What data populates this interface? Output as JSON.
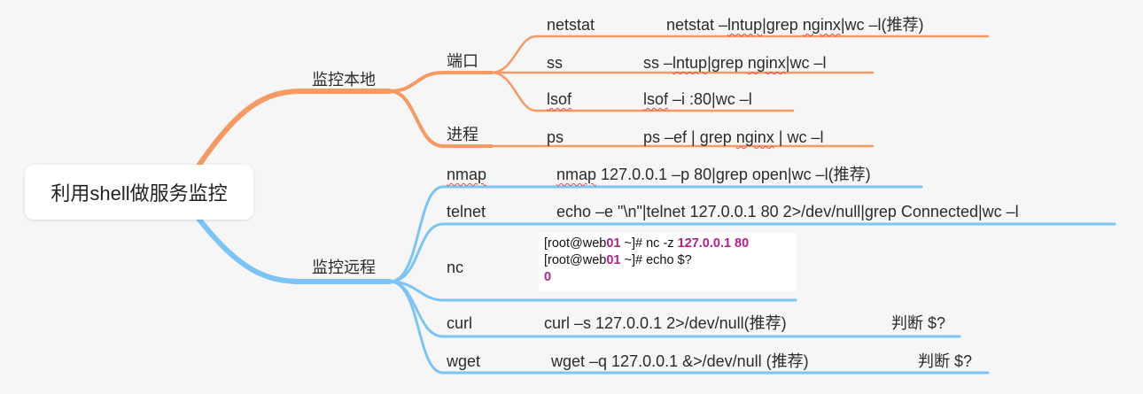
{
  "root": {
    "label": "利用shell做服务监控"
  },
  "colors": {
    "local_branch": "#f59a63",
    "remote_branch": "#7cc4f5"
  },
  "local": {
    "label": "监控本地",
    "port": {
      "label": "端口",
      "items": [
        {
          "tool": "netstat",
          "cmd": "netstat –lntup|grep nginx|wc –l(推荐)"
        },
        {
          "tool": "ss",
          "cmd": "ss –lntup|grep nginx|wc –l"
        },
        {
          "tool": "lsof",
          "cmd": "lsof –i :80|wc –l"
        }
      ]
    },
    "process": {
      "label": "进程",
      "items": [
        {
          "tool": "ps",
          "cmd": "ps –ef | grep nginx | wc –l"
        }
      ]
    }
  },
  "remote": {
    "label": "监控远程",
    "items": [
      {
        "tool": "nmap",
        "cmd": "nmap 127.0.0.1 –p 80|grep open|wc –l(推荐)"
      },
      {
        "tool": "telnet",
        "cmd": "echo –e \"\\n\"|telnet 127.0.0.1 80 2>/dev/null|grep Connected|wc –l"
      },
      {
        "tool": "nc",
        "terminal": {
          "line1_a": "[root@web",
          "line1_b": "01",
          "line1_c": " ~]# nc -z ",
          "line1_d": "127.0.0.1 80",
          "line2_a": "[root@web",
          "line2_b": "01",
          "line2_c": " ~]# echo $?",
          "line3": "0"
        }
      },
      {
        "tool": "curl",
        "cmd": "curl –s 127.0.0.1 2>/dev/null(推荐)",
        "note": "判断 $?"
      },
      {
        "tool": "wget",
        "cmd": "wget –q 127.0.0.1 &>/dev/null (推荐)",
        "note": "判断 $?"
      }
    ]
  }
}
